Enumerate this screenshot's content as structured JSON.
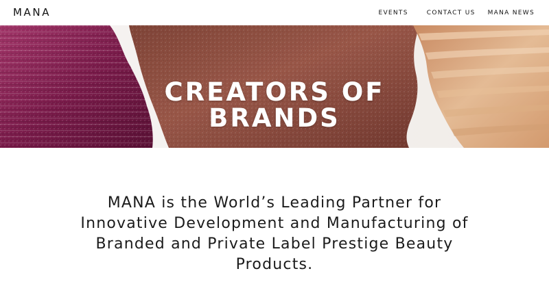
{
  "header": {
    "logo": "MANA",
    "nav": [
      {
        "label": "EVENTS"
      },
      {
        "label": "CONTACT US"
      },
      {
        "label": "MANA NEWS"
      }
    ]
  },
  "hero": {
    "title_lines": [
      "CREATORS OF",
      "BRANDS"
    ],
    "swatches": [
      "plum-lipstick",
      "bronze-shimmer",
      "beige-foundation"
    ],
    "colors": {
      "plum": "#7d1f4e",
      "bronze": "#9c5446",
      "beige": "#d9a57c"
    }
  },
  "intro": {
    "lines": [
      "MANA is the World’s Leading Partner for",
      "Innovative Development and Manufacturing of",
      "Branded and Private Label Prestige Beauty",
      "Products."
    ]
  }
}
